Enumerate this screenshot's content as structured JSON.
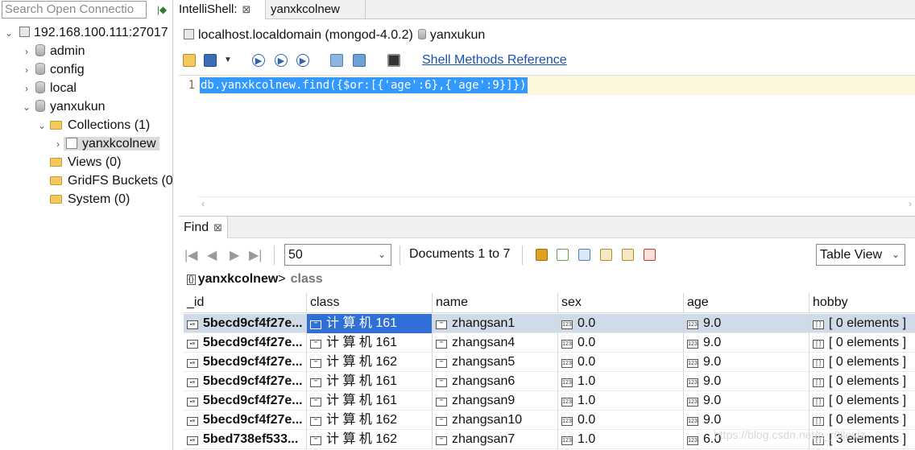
{
  "sidebar": {
    "search_placeholder": "Search Open Connectio",
    "connection": "192.168.100.111:27017",
    "databases": [
      "admin",
      "config",
      "local",
      "yanxukun"
    ],
    "collections_folder": "Collections (1)",
    "collection": "yanxkcolnew",
    "views_folder": "Views (0)",
    "gridfs_folder": "GridFS Buckets (0",
    "system_folder": "System (0)"
  },
  "tabs": {
    "intellishell": "IntelliShell:",
    "collection_tab": "yanxkcolnew",
    "close_glyph": "⊠"
  },
  "conn_bar": {
    "host": "localhost.localdomain (mongod-4.0.2)",
    "db": "yanxukun"
  },
  "toolbar": {
    "shell_ref": "Shell Methods Reference"
  },
  "editor": {
    "line_number": "1",
    "code": "db.yanxkcolnew.find({$or:[{'age':6},{'age':9}]})"
  },
  "find": {
    "tab_label": "Find",
    "page_size": "50",
    "docs_label": "Documents 1 to 7",
    "view_mode": "Table View",
    "path_collection": "yanxkcolnew",
    "path_sep": ">",
    "path_field": "class"
  },
  "table": {
    "columns": [
      "_id",
      "class",
      "name",
      "sex",
      "age",
      "hobby"
    ],
    "rows": [
      {
        "id": "5becd9cf4f27e...",
        "class": "计 算 机 161",
        "name": "zhangsan1",
        "sex": "0.0",
        "age": "9.0",
        "hobby": "[ 0 elements ]"
      },
      {
        "id": "5becd9cf4f27e...",
        "class": "计 算 机 161",
        "name": "zhangsan4",
        "sex": "0.0",
        "age": "9.0",
        "hobby": "[ 0 elements ]"
      },
      {
        "id": "5becd9cf4f27e...",
        "class": "计 算 机 162",
        "name": "zhangsan5",
        "sex": "0.0",
        "age": "9.0",
        "hobby": "[ 0 elements ]"
      },
      {
        "id": "5becd9cf4f27e...",
        "class": "计 算 机 161",
        "name": "zhangsan6",
        "sex": "1.0",
        "age": "9.0",
        "hobby": "[ 0 elements ]"
      },
      {
        "id": "5becd9cf4f27e...",
        "class": "计 算 机 161",
        "name": "zhangsan9",
        "sex": "1.0",
        "age": "9.0",
        "hobby": "[ 0 elements ]"
      },
      {
        "id": "5becd9cf4f27e...",
        "class": "计 算 机 162",
        "name": "zhangsan10",
        "sex": "0.0",
        "age": "9.0",
        "hobby": "[ 0 elements ]"
      },
      {
        "id": "5bed738ef533...",
        "class": "计 算 机 162",
        "name": "zhangsan7",
        "sex": "1.0",
        "age": "6.0",
        "hobby": "[ 3 elements ]"
      }
    ]
  },
  "watermark": "https://blog.csdn.net/a_r0lleyiz"
}
